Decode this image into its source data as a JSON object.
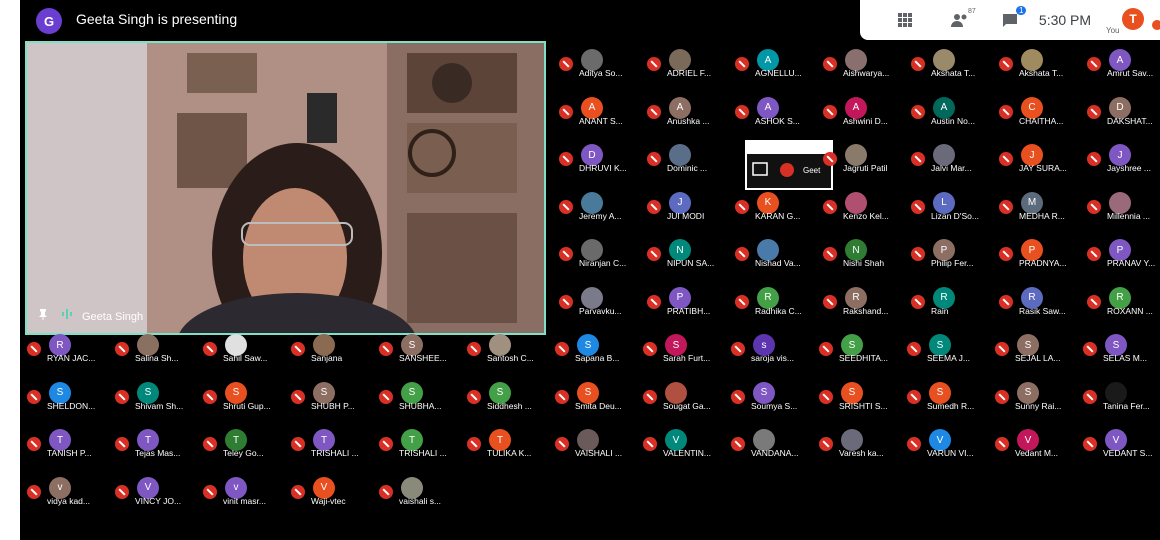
{
  "topbar": {
    "presenter_initial": "G",
    "presenting_text": "Geeta Singh is presenting",
    "people_count": "87",
    "chat_badge": "1",
    "time": "5:30 PM",
    "you_initial": "T",
    "you_label": "You"
  },
  "main_video": {
    "name": "Geeta Singh"
  },
  "screenshare": {
    "label": "Geet"
  },
  "participants": [
    {
      "name": "Aditya So...",
      "initial": "",
      "color": "#6b6b6b",
      "photo": true
    },
    {
      "name": "ADRIEL F...",
      "initial": "",
      "color": "#7a6a5a",
      "photo": true
    },
    {
      "name": "AGNELLU...",
      "initial": "A",
      "color": "#0097a7"
    },
    {
      "name": "Aishwarya...",
      "initial": "",
      "color": "#8a6f6f",
      "photo": true
    },
    {
      "name": "Akshata T...",
      "initial": "",
      "color": "#9a8a6a",
      "photo": true
    },
    {
      "name": "Akshata T...",
      "initial": "",
      "color": "#a08a60",
      "photo": true
    },
    {
      "name": "Amrut Sav...",
      "initial": "A",
      "color": "#7e57c2"
    },
    {
      "name": "ANANT S...",
      "initial": "A",
      "color": "#e8501f"
    },
    {
      "name": "Anushka ...",
      "initial": "A",
      "color": "#8d6e63"
    },
    {
      "name": "ASHOK S...",
      "initial": "A",
      "color": "#7e57c2"
    },
    {
      "name": "Ashwini D...",
      "initial": "A",
      "color": "#c2185b"
    },
    {
      "name": "Austin No...",
      "initial": "A",
      "color": "#00695c"
    },
    {
      "name": "CHAITHA...",
      "initial": "C",
      "color": "#e8501f"
    },
    {
      "name": "DAKSHAT...",
      "initial": "D",
      "color": "#8d6e63"
    },
    {
      "name": "DHRUVI K...",
      "initial": "D",
      "color": "#7e57c2"
    },
    {
      "name": "Dominic ...",
      "initial": "",
      "color": "#5a6e8a",
      "photo": true
    },
    {
      "name": "Jagruti Patil",
      "initial": "",
      "color": "#8a7a6a",
      "photo": true
    },
    {
      "name": "Jalvi Mar...",
      "initial": "",
      "color": "#6a6a7a",
      "photo": true
    },
    {
      "name": "JAY SURA...",
      "initial": "J",
      "color": "#e8501f"
    },
    {
      "name": "Jayshree ...",
      "initial": "J",
      "color": "#7e57c2"
    },
    {
      "name": "Jeremy A...",
      "initial": "",
      "color": "#4a7a9a",
      "photo": true
    },
    {
      "name": "JUI MODI",
      "initial": "J",
      "color": "#5c6bc0"
    },
    {
      "name": "KARAN G...",
      "initial": "K",
      "color": "#e8501f"
    },
    {
      "name": "Kenzo Kel...",
      "initial": "",
      "color": "#b05070",
      "photo": true
    },
    {
      "name": "Lizan D'So...",
      "initial": "L",
      "color": "#5c6bc0"
    },
    {
      "name": "MEDHA R...",
      "initial": "M",
      "color": "#5c6b7c"
    },
    {
      "name": "Millennia ...",
      "initial": "",
      "color": "#9a6a7a",
      "photo": true
    },
    {
      "name": "Niranjan C...",
      "initial": "",
      "color": "#6a6a6a",
      "photo": true
    },
    {
      "name": "NIPUN SA...",
      "initial": "N",
      "color": "#00897b"
    },
    {
      "name": "Nishad Va...",
      "initial": "",
      "color": "#4a7aaa",
      "photo": true
    },
    {
      "name": "Nishi Shah",
      "initial": "N",
      "color": "#2e7d32"
    },
    {
      "name": "Philip Fer...",
      "initial": "P",
      "color": "#8d6e63"
    },
    {
      "name": "PRADNYA...",
      "initial": "P",
      "color": "#e8501f"
    },
    {
      "name": "PRANAV Y...",
      "initial": "P",
      "color": "#7e57c2"
    },
    {
      "name": "Parvavku...",
      "initial": "",
      "color": "#7a7a8a",
      "photo": true
    },
    {
      "name": "PRATIBH...",
      "initial": "P",
      "color": "#7e57c2"
    },
    {
      "name": "Radhika C...",
      "initial": "R",
      "color": "#43a047"
    },
    {
      "name": "Rakshand...",
      "initial": "R",
      "color": "#8d6e63"
    },
    {
      "name": "Rain",
      "initial": "R",
      "color": "#00897b"
    },
    {
      "name": "Rasik Saw...",
      "initial": "R",
      "color": "#5c6bc0"
    },
    {
      "name": "ROXANN ...",
      "initial": "R",
      "color": "#43a047"
    },
    {
      "name": "RYAN JAC...",
      "initial": "R",
      "color": "#7e57c2"
    },
    {
      "name": "Salina Sh...",
      "initial": "",
      "color": "#8a7060",
      "photo": true
    },
    {
      "name": "Sahil Saw...",
      "initial": "",
      "color": "#e0e0e0",
      "photo": true
    },
    {
      "name": "Sanjana",
      "initial": "",
      "color": "#8a6a50",
      "photo": true
    },
    {
      "name": "SANSHEE...",
      "initial": "S",
      "color": "#8d6e63"
    },
    {
      "name": "Santosh C...",
      "initial": "",
      "color": "#a09080",
      "photo": true
    },
    {
      "name": "Sapana B...",
      "initial": "S",
      "color": "#1e88e5"
    },
    {
      "name": "Sarah Furt...",
      "initial": "S",
      "color": "#c2185b"
    },
    {
      "name": "saroja vis...",
      "initial": "s",
      "color": "#5e35b1"
    },
    {
      "name": "SEEDHITA...",
      "initial": "S",
      "color": "#43a047"
    },
    {
      "name": "SEEMA J...",
      "initial": "S",
      "color": "#00897b"
    },
    {
      "name": "SEJAL LA...",
      "initial": "S",
      "color": "#8d6e63"
    },
    {
      "name": "SELAS M...",
      "initial": "S",
      "color": "#7e57c2"
    },
    {
      "name": "SHELDON...",
      "initial": "S",
      "color": "#1e88e5"
    },
    {
      "name": "Shivam Sh...",
      "initial": "S",
      "color": "#00897b"
    },
    {
      "name": "Shruti Gup...",
      "initial": "S",
      "color": "#e8501f"
    },
    {
      "name": "SHUBH P...",
      "initial": "S",
      "color": "#8d6e63"
    },
    {
      "name": "SHUBHA...",
      "initial": "S",
      "color": "#43a047"
    },
    {
      "name": "Siddhesh ...",
      "initial": "S",
      "color": "#43a047"
    },
    {
      "name": "Smita Deu...",
      "initial": "S",
      "color": "#e8501f"
    },
    {
      "name": "Sougat Ga...",
      "initial": "",
      "color": "#b05040",
      "photo": true
    },
    {
      "name": "Soumya S...",
      "initial": "S",
      "color": "#7e57c2"
    },
    {
      "name": "SRISHTI S...",
      "initial": "S",
      "color": "#e8501f"
    },
    {
      "name": "Sumedh R...",
      "initial": "S",
      "color": "#e8501f"
    },
    {
      "name": "Sunny Rai...",
      "initial": "S",
      "color": "#8d6e63"
    },
    {
      "name": "Tanina Fer...",
      "initial": "",
      "color": "#1a1a1a",
      "photo": true
    },
    {
      "name": "TANISH P...",
      "initial": "T",
      "color": "#7e57c2"
    },
    {
      "name": "Tejas Mas...",
      "initial": "T",
      "color": "#7e57c2"
    },
    {
      "name": "Teley Go...",
      "initial": "T",
      "color": "#2e7d32"
    },
    {
      "name": "TRISHALI ...",
      "initial": "T",
      "color": "#7e57c2"
    },
    {
      "name": "TRISHALI ...",
      "initial": "T",
      "color": "#43a047"
    },
    {
      "name": "TULIKA K...",
      "initial": "T",
      "color": "#e8501f"
    },
    {
      "name": "VAISHALI ...",
      "initial": "",
      "color": "#6a5a5a",
      "photo": true
    },
    {
      "name": "VALENTIN...",
      "initial": "V",
      "color": "#00897b"
    },
    {
      "name": "VANDANA...",
      "initial": "",
      "color": "#7a7a7a",
      "photo": true
    },
    {
      "name": "Varesh ka...",
      "initial": "",
      "color": "#6a6a7a",
      "photo": true
    },
    {
      "name": "VARUN VI...",
      "initial": "V",
      "color": "#1e88e5"
    },
    {
      "name": "Vedant M...",
      "initial": "V",
      "color": "#c2185b"
    },
    {
      "name": "VEDANT S...",
      "initial": "V",
      "color": "#7e57c2"
    },
    {
      "name": "vidya kad...",
      "initial": "v",
      "color": "#8d6e63"
    },
    {
      "name": "VINCY JO...",
      "initial": "V",
      "color": "#7e57c2"
    },
    {
      "name": "vinit masr...",
      "initial": "v",
      "color": "#7e57c2"
    },
    {
      "name": "Waji-vtec",
      "initial": "V",
      "color": "#e8501f"
    },
    {
      "name": "vaishali s...",
      "initial": "",
      "color": "#8a8a7a",
      "photo": true
    }
  ]
}
